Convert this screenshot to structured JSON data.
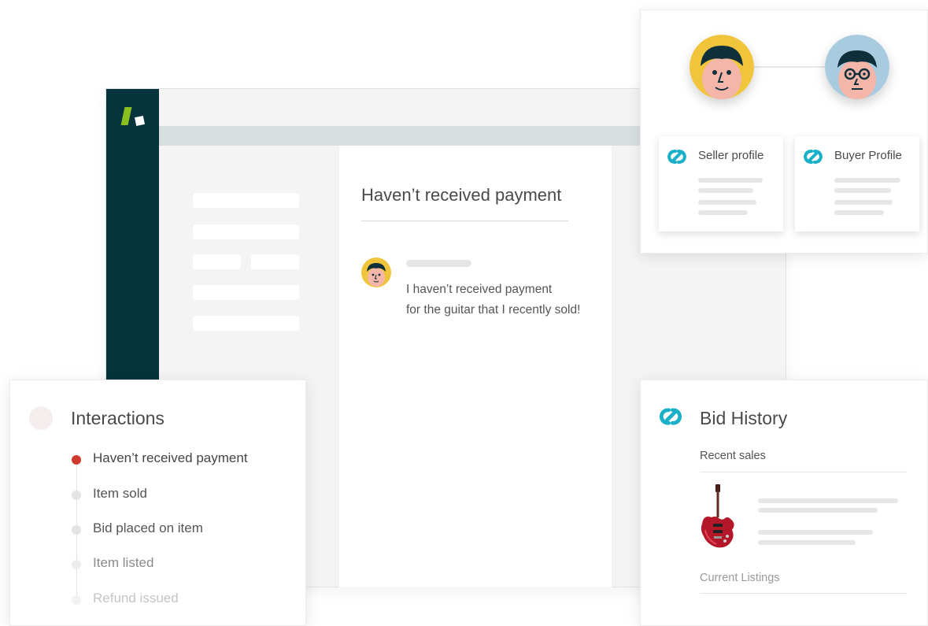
{
  "conversation": {
    "title": "Haven’t received payment",
    "message_line1": "I haven’t received payment",
    "message_line2": "for the guitar that I recently sold!"
  },
  "profiles": {
    "seller_label": "Seller profile",
    "buyer_label": "Buyer Profile"
  },
  "interactions": {
    "title": "Interactions",
    "items": [
      {
        "label": "Haven’t received payment",
        "active": true
      },
      {
        "label": "Item sold",
        "active": false
      },
      {
        "label": "Bid placed on item",
        "active": false
      },
      {
        "label": "Item listed",
        "active": false
      },
      {
        "label": "Refund issued",
        "active": false
      }
    ]
  },
  "bid_history": {
    "title": "Bid History",
    "recent_sales_label": "Recent sales",
    "current_listings_label": "Current Listings"
  },
  "colors": {
    "sidebar": "#05343c",
    "logo_green": "#8bbf1f",
    "accent_teal": "#1ab0c8",
    "active_red": "#d0392f",
    "seller_avatar_bg": "#f0c53b",
    "buyer_avatar_bg": "#a9cbe0"
  },
  "icons": {
    "logo": "brand-logo-icon",
    "link": "chain-link-icon",
    "guitar": "electric-guitar-icon"
  }
}
